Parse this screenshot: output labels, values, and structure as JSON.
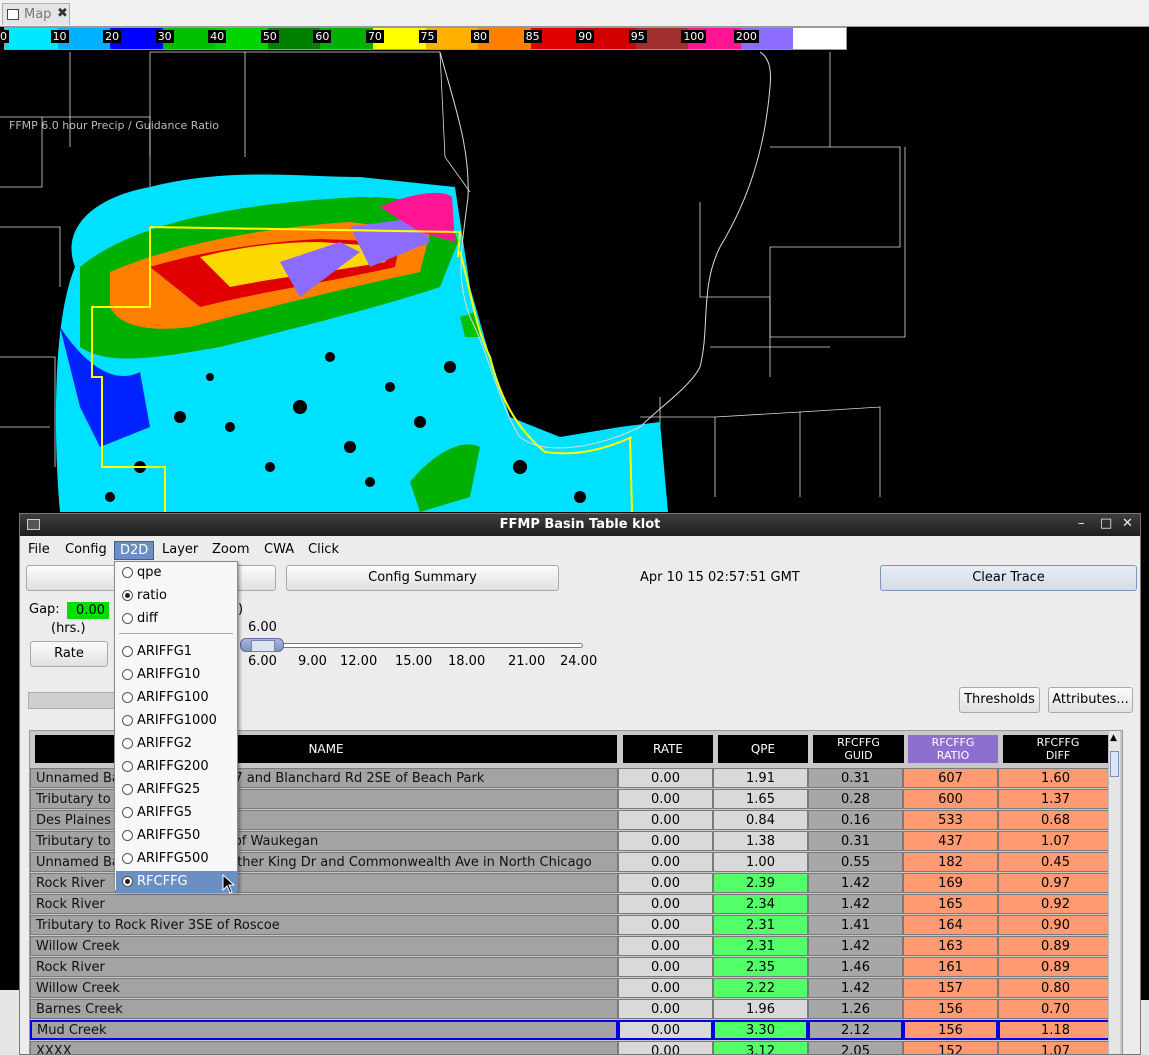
{
  "tab": {
    "label": "Map",
    "close": "✖"
  },
  "colorbar": {
    "labels": [
      "0",
      "10",
      "20",
      "30",
      "40",
      "50",
      "60",
      "70",
      "75",
      "80",
      "85",
      "90",
      "95",
      "100",
      "200",
      ""
    ],
    "colors": [
      "#00e8ff",
      "#00b0ff",
      "#0000ff",
      "#00c000",
      "#00d400",
      "#008000",
      "#00b000",
      "#ffff00",
      "#ffb000",
      "#ff8000",
      "#e00000",
      "#d00000",
      "#a03030",
      "#ff1493",
      "#8b6cff",
      "#ffffff"
    ]
  },
  "map": {
    "title": "FFMP 6.0 hour Precip / Guidance Ratio"
  },
  "window": {
    "title": "FFMP Basin Table klot"
  },
  "menu": [
    "File",
    "Config",
    "D2D",
    "Layer",
    "Zoom",
    "CWA",
    "Click"
  ],
  "toolbar": {
    "config_summary": "Config Summary",
    "timestamp": "Apr 10 15 02:57:51 GMT",
    "clear_trace": "Clear Trace",
    "thresholds": "Thresholds",
    "attributes": "Attributes...",
    "rate": "Rate"
  },
  "gap": {
    "label": "Gap:",
    "value": "0.00",
    "unit": "(hrs.)"
  },
  "slider": {
    "paren": ")",
    "value": "6.00",
    "ticks": [
      "6.00",
      "9.00",
      "12.00",
      "15.00",
      "18.00",
      "21.00",
      "24.00"
    ]
  },
  "popup": {
    "items": [
      {
        "label": "qpe",
        "checked": false
      },
      {
        "label": "ratio",
        "checked": true
      },
      {
        "label": "diff",
        "checked": false
      },
      {
        "label": "ARIFFG1",
        "checked": false
      },
      {
        "label": "ARIFFG10",
        "checked": false
      },
      {
        "label": "ARIFFG100",
        "checked": false
      },
      {
        "label": "ARIFFG1000",
        "checked": false
      },
      {
        "label": "ARIFFG2",
        "checked": false
      },
      {
        "label": "ARIFFG200",
        "checked": false
      },
      {
        "label": "ARIFFG25",
        "checked": false
      },
      {
        "label": "ARIFFG5",
        "checked": false
      },
      {
        "label": "ARIFFG50",
        "checked": false
      },
      {
        "label": "ARIFFG500",
        "checked": false
      },
      {
        "label": "RFCFFG",
        "checked": true
      }
    ]
  },
  "table": {
    "headers": [
      {
        "key": "name",
        "label": "NAME"
      },
      {
        "key": "rate",
        "label": "RATE"
      },
      {
        "key": "qpe",
        "label": "QPE"
      },
      {
        "key": "guid",
        "label": "RFCFFG\nGUID"
      },
      {
        "key": "ratio",
        "label": "RFCFFG\nRATIO"
      },
      {
        "key": "diff",
        "label": "RFCFFG\nDIFF"
      }
    ],
    "rows": [
      {
        "name": "Unnamed Basin near IL Rte 137 and Blanchard Rd 2SE of Beach Park",
        "rate": "0.00",
        "qpe": "1.91",
        "guid": "0.31",
        "ratio": "607",
        "diff": "1.60",
        "qpe_high": false
      },
      {
        "name": "Tributary to Lake Michigan",
        "rate": "0.00",
        "qpe": "1.65",
        "guid": "0.28",
        "ratio": "600",
        "diff": "1.37",
        "qpe_high": false
      },
      {
        "name": "Des Plaines River",
        "rate": "0.00",
        "qpe": "0.84",
        "guid": "0.16",
        "ratio": "533",
        "diff": "0.68",
        "qpe_high": false
      },
      {
        "name": "Tributary to Lake Michigan 1N of Waukegan",
        "rate": "0.00",
        "qpe": "1.38",
        "guid": "0.31",
        "ratio": "437",
        "diff": "1.07",
        "qpe_high": false
      },
      {
        "name": "Unnamed Basin near Martin Luther King Dr and Commonwealth Ave in North Chicago",
        "rate": "0.00",
        "qpe": "1.00",
        "guid": "0.55",
        "ratio": "182",
        "diff": "0.45",
        "qpe_high": false
      },
      {
        "name": "Rock River",
        "rate": "0.00",
        "qpe": "2.39",
        "guid": "1.42",
        "ratio": "169",
        "diff": "0.97",
        "qpe_high": true
      },
      {
        "name": "Rock River",
        "rate": "0.00",
        "qpe": "2.34",
        "guid": "1.42",
        "ratio": "165",
        "diff": "0.92",
        "qpe_high": true
      },
      {
        "name": "Tributary to Rock River 3SE of Roscoe",
        "rate": "0.00",
        "qpe": "2.31",
        "guid": "1.41",
        "ratio": "164",
        "diff": "0.90",
        "qpe_high": true
      },
      {
        "name": "Willow Creek",
        "rate": "0.00",
        "qpe": "2.31",
        "guid": "1.42",
        "ratio": "163",
        "diff": "0.89",
        "qpe_high": true
      },
      {
        "name": "Rock River",
        "rate": "0.00",
        "qpe": "2.35",
        "guid": "1.46",
        "ratio": "161",
        "diff": "0.89",
        "qpe_high": true
      },
      {
        "name": "Willow Creek",
        "rate": "0.00",
        "qpe": "2.22",
        "guid": "1.42",
        "ratio": "157",
        "diff": "0.80",
        "qpe_high": true
      },
      {
        "name": "Barnes Creek",
        "rate": "0.00",
        "qpe": "1.96",
        "guid": "1.26",
        "ratio": "156",
        "diff": "0.70",
        "qpe_high": false
      },
      {
        "name": "Mud Creek",
        "rate": "0.00",
        "qpe": "3.30",
        "guid": "2.12",
        "ratio": "156",
        "diff": "1.18",
        "qpe_high": true,
        "selected": true
      },
      {
        "name": "XXXX",
        "rate": "0.00",
        "qpe": "3.12",
        "guid": "2.05",
        "ratio": "152",
        "diff": "1.07",
        "qpe_high": true
      }
    ]
  }
}
